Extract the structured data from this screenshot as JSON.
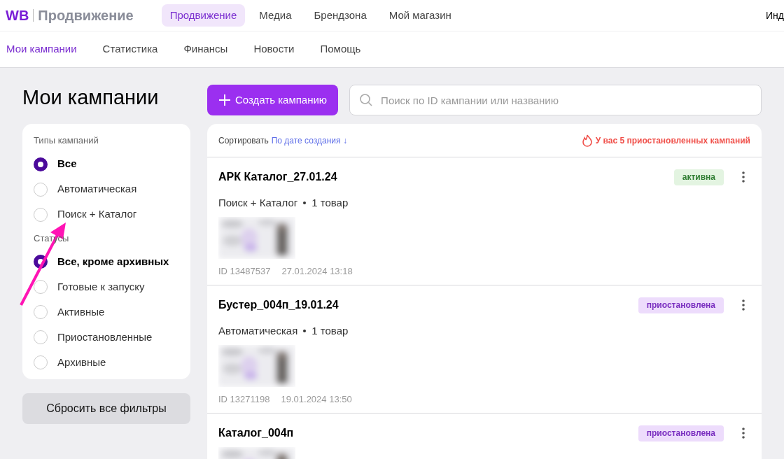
{
  "header": {
    "logo_mark": "WB",
    "logo_text": "Продвижение",
    "tabs": [
      {
        "label": "Продвижение",
        "selected": true
      },
      {
        "label": "Медиа",
        "selected": false
      },
      {
        "label": "Брендзона",
        "selected": false
      },
      {
        "label": "Мой магазин",
        "selected": false
      }
    ],
    "account": "Инд"
  },
  "subnav": [
    {
      "label": "Мои кампании",
      "selected": true
    },
    {
      "label": "Статистика",
      "selected": false
    },
    {
      "label": "Финансы",
      "selected": false
    },
    {
      "label": "Новости",
      "selected": false
    },
    {
      "label": "Помощь",
      "selected": false
    }
  ],
  "page_title": "Мои кампании",
  "filters": [
    {
      "heading": "Типы кампаний",
      "options": [
        {
          "label": "Все",
          "selected": true
        },
        {
          "label": "Автоматическая",
          "selected": false
        },
        {
          "label": "Поиск + Каталог",
          "selected": false
        }
      ]
    },
    {
      "heading": "Статусы",
      "options": [
        {
          "label": "Все, кроме архивных",
          "selected": true
        },
        {
          "label": "Готовые к запуску",
          "selected": false
        },
        {
          "label": "Активные",
          "selected": false
        },
        {
          "label": "Приостановленные",
          "selected": false
        },
        {
          "label": "Архивные",
          "selected": false
        }
      ]
    }
  ],
  "reset_button": "Сбросить все фильтры",
  "create_button": "Создать кампанию",
  "search": {
    "placeholder": "Поиск по ID кампании или названию"
  },
  "sort": {
    "label": "Сортировать",
    "value": "По дате создания",
    "arrow": "↓"
  },
  "alert": "У вас 5 приостановленных кампаний",
  "campaigns": [
    {
      "name": "АРК Каталог_27.01.24",
      "status": "активна",
      "kind": "active",
      "type": "Поиск + Каталог",
      "count": "1 товар",
      "id": "ID 13487537",
      "date": "27.01.2024 13:18"
    },
    {
      "name": "Бустер_004п_19.01.24",
      "status": "приостановлена",
      "kind": "paused",
      "type": "Автоматическая",
      "count": "1 товар",
      "id": "ID 13271198",
      "date": "19.01.2024 13:50"
    },
    {
      "name": "Каталог_004п",
      "status": "приостановлена",
      "kind": "paused"
    }
  ]
}
